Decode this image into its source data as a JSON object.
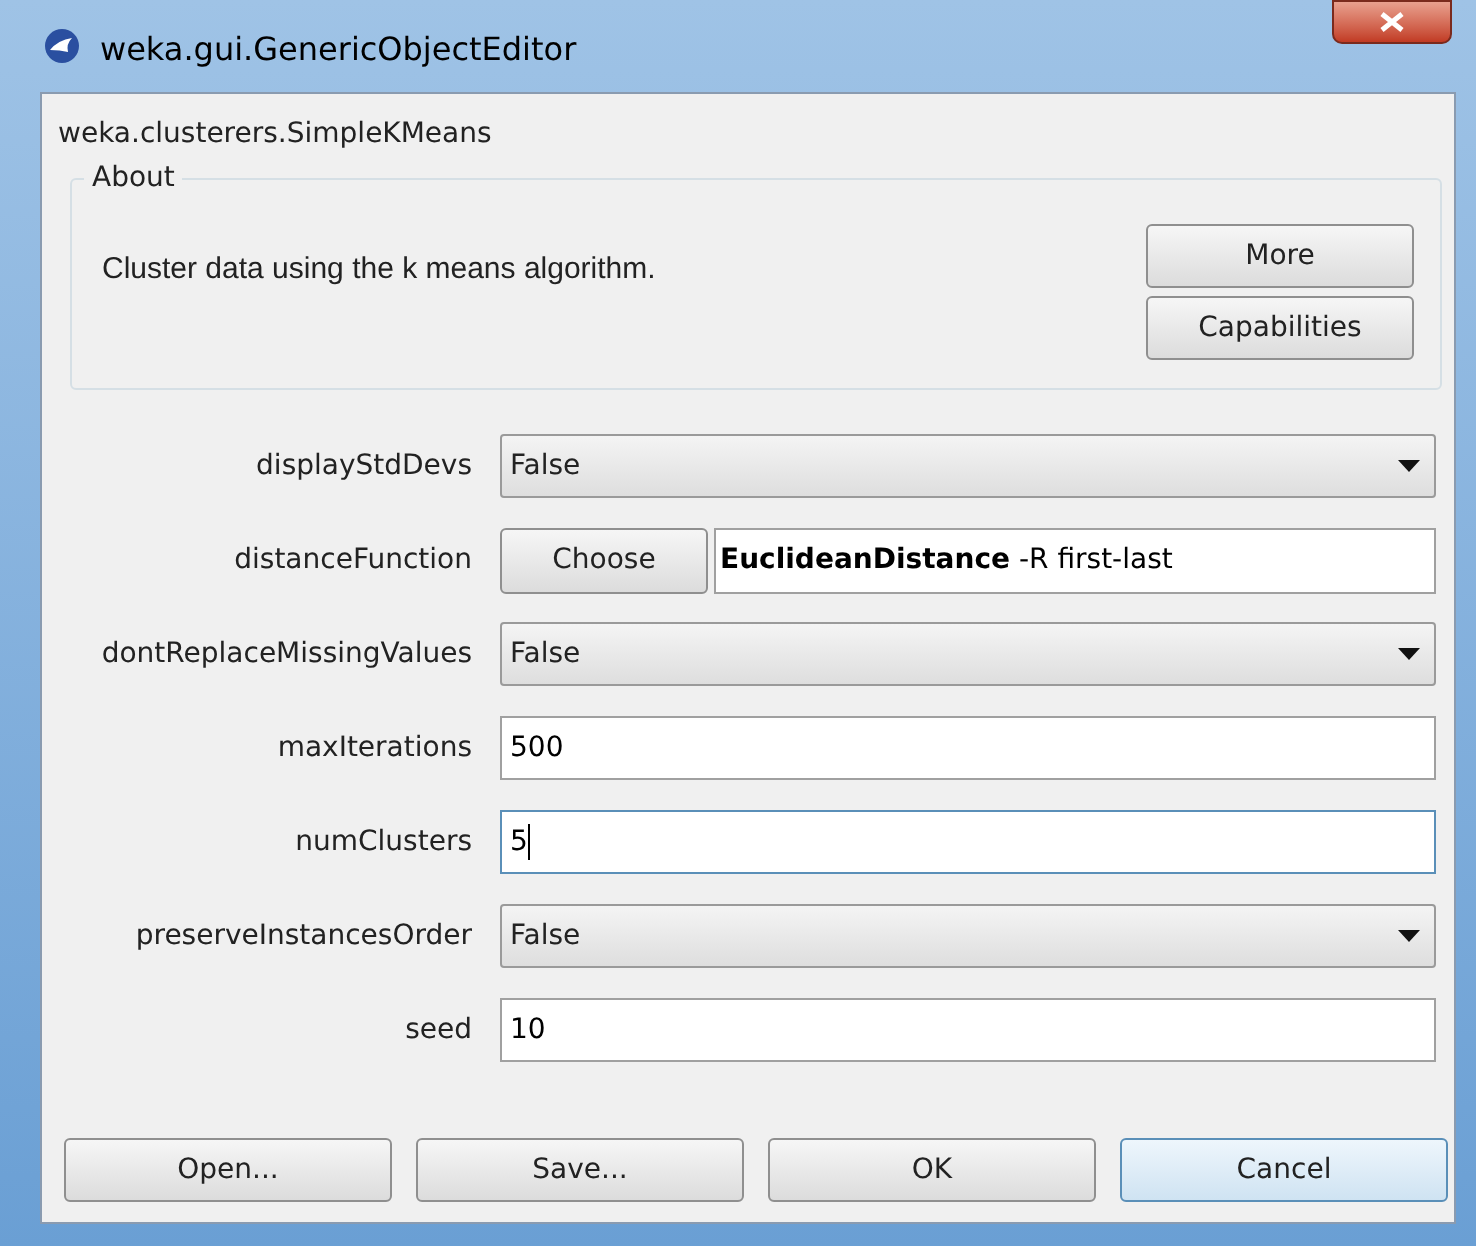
{
  "window": {
    "title": "weka.gui.GenericObjectEditor"
  },
  "class_name": "weka.clusterers.SimpleKMeans",
  "about": {
    "title": "About",
    "description": "Cluster data using the k means algorithm.",
    "buttons": [
      "More",
      "Capabilities"
    ]
  },
  "properties": [
    {
      "label": "displayStdDevs",
      "kind": "dropdown",
      "value": "False"
    },
    {
      "label": "distanceFunction",
      "kind": "chooser",
      "button": "Choose",
      "value": "**EuclideanDistance** -R first-last"
    },
    {
      "label": "dontReplaceMissingValues",
      "kind": "dropdown",
      "value": "False"
    },
    {
      "label": "maxIterations",
      "kind": "text",
      "value": "500",
      "focused": false
    },
    {
      "label": "numClusters",
      "kind": "text",
      "value": "5",
      "focused": true
    },
    {
      "label": "preserveInstancesOrder",
      "kind": "dropdown",
      "value": "False"
    },
    {
      "label": "seed",
      "kind": "text",
      "value": "10",
      "focused": false
    }
  ],
  "buttons": [
    {
      "label": "Open...",
      "focused": false
    },
    {
      "label": "Save...",
      "focused": false
    },
    {
      "label": "OK",
      "focused": false
    },
    {
      "label": "Cancel",
      "focused": true
    }
  ]
}
